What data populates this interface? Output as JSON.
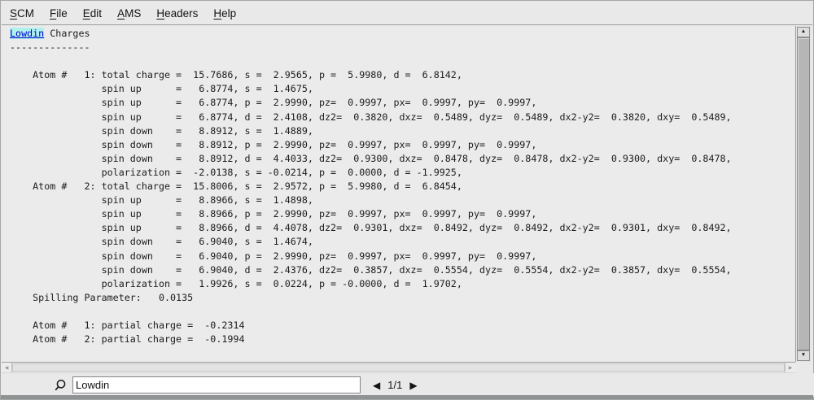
{
  "menu": {
    "items": [
      {
        "label": "SCM",
        "underline": 0
      },
      {
        "label": "File",
        "underline": 0
      },
      {
        "label": "Edit",
        "underline": 0
      },
      {
        "label": "AMS",
        "underline": 0
      },
      {
        "label": "Headers",
        "underline": 0
      },
      {
        "label": "Help",
        "underline": 0
      }
    ]
  },
  "editor": {
    "first_line": {
      "match": "Lowdin",
      "rest": " Charges"
    },
    "highlight_bg": "#aef0ee",
    "highlight_text_color": "#0000cd",
    "lines": [
      "--------------",
      "",
      "    Atom #   1: total charge =  15.7686, s =  2.9565, p =  5.9980, d =  6.8142,",
      "                spin up      =   6.8774, s =  1.4675,",
      "                spin up      =   6.8774, p =  2.9990, pz=  0.9997, px=  0.9997, py=  0.9997,",
      "                spin up      =   6.8774, d =  2.4108, dz2=  0.3820, dxz=  0.5489, dyz=  0.5489, dx2-y2=  0.3820, dxy=  0.5489,",
      "                spin down    =   8.8912, s =  1.4889,",
      "                spin down    =   8.8912, p =  2.9990, pz=  0.9997, px=  0.9997, py=  0.9997,",
      "                spin down    =   8.8912, d =  4.4033, dz2=  0.9300, dxz=  0.8478, dyz=  0.8478, dx2-y2=  0.9300, dxy=  0.8478,",
      "                polarization =  -2.0138, s = -0.0214, p =  0.0000, d = -1.9925,",
      "    Atom #   2: total charge =  15.8006, s =  2.9572, p =  5.9980, d =  6.8454,",
      "                spin up      =   8.8966, s =  1.4898,",
      "                spin up      =   8.8966, p =  2.9990, pz=  0.9997, px=  0.9997, py=  0.9997,",
      "                spin up      =   8.8966, d =  4.4078, dz2=  0.9301, dxz=  0.8492, dyz=  0.8492, dx2-y2=  0.9301, dxy=  0.8492,",
      "                spin down    =   6.9040, s =  1.4674,",
      "                spin down    =   6.9040, p =  2.9990, pz=  0.9997, px=  0.9997, py=  0.9997,",
      "                spin down    =   6.9040, d =  2.4376, dz2=  0.3857, dxz=  0.5554, dyz=  0.5554, dx2-y2=  0.3857, dxy=  0.5554,",
      "                polarization =   1.9926, s =  0.0224, p = -0.0000, d =  1.9702,",
      "    Spilling Parameter:   0.0135",
      "",
      "    Atom #   1: partial charge =  -0.2314",
      "    Atom #   2: partial charge =  -0.1994"
    ]
  },
  "scrollbars": {
    "up_arrow": "▲",
    "down_arrow": "▼",
    "left_arrow": "◀",
    "right_arrow": "▶"
  },
  "search_bar": {
    "query": "Lowdin",
    "prev_icon": "◀",
    "next_icon": "▶",
    "position": "1/1"
  }
}
